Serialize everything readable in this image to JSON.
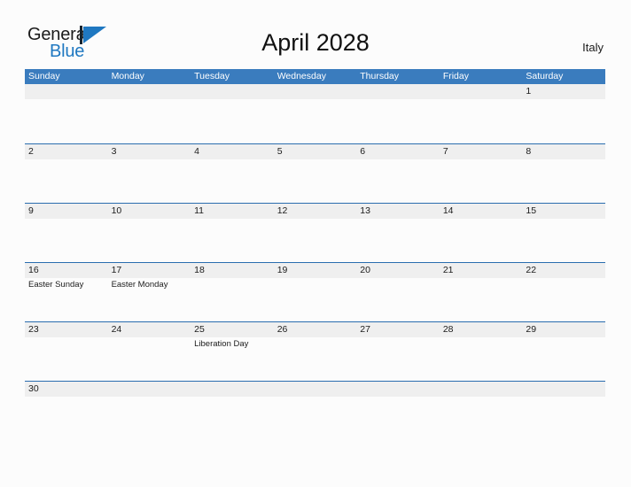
{
  "brand": {
    "name_part1": "General",
    "name_part2": "Blue",
    "accent_color": "#1f78c1"
  },
  "header": {
    "title": "April 2028",
    "country": "Italy"
  },
  "theme": {
    "header_blue": "#3a7cbe",
    "rule_blue": "#2a6daf",
    "band_gray": "#efefef",
    "page_background": "#fcfcfc"
  },
  "calendar": {
    "day_headers": [
      "Sunday",
      "Monday",
      "Tuesday",
      "Wednesday",
      "Thursday",
      "Friday",
      "Saturday"
    ],
    "weeks": [
      {
        "short": false,
        "days": [
          {
            "num": "",
            "events": []
          },
          {
            "num": "",
            "events": []
          },
          {
            "num": "",
            "events": []
          },
          {
            "num": "",
            "events": []
          },
          {
            "num": "",
            "events": []
          },
          {
            "num": "",
            "events": []
          },
          {
            "num": "1",
            "events": []
          }
        ]
      },
      {
        "short": false,
        "days": [
          {
            "num": "2",
            "events": []
          },
          {
            "num": "3",
            "events": []
          },
          {
            "num": "4",
            "events": []
          },
          {
            "num": "5",
            "events": []
          },
          {
            "num": "6",
            "events": []
          },
          {
            "num": "7",
            "events": []
          },
          {
            "num": "8",
            "events": []
          }
        ]
      },
      {
        "short": false,
        "days": [
          {
            "num": "9",
            "events": []
          },
          {
            "num": "10",
            "events": []
          },
          {
            "num": "11",
            "events": []
          },
          {
            "num": "12",
            "events": []
          },
          {
            "num": "13",
            "events": []
          },
          {
            "num": "14",
            "events": []
          },
          {
            "num": "15",
            "events": []
          }
        ]
      },
      {
        "short": false,
        "days": [
          {
            "num": "16",
            "events": [
              "Easter Sunday"
            ]
          },
          {
            "num": "17",
            "events": [
              "Easter Monday"
            ]
          },
          {
            "num": "18",
            "events": []
          },
          {
            "num": "19",
            "events": []
          },
          {
            "num": "20",
            "events": []
          },
          {
            "num": "21",
            "events": []
          },
          {
            "num": "22",
            "events": []
          }
        ]
      },
      {
        "short": false,
        "days": [
          {
            "num": "23",
            "events": []
          },
          {
            "num": "24",
            "events": []
          },
          {
            "num": "25",
            "events": [
              "Liberation Day"
            ]
          },
          {
            "num": "26",
            "events": []
          },
          {
            "num": "27",
            "events": []
          },
          {
            "num": "28",
            "events": []
          },
          {
            "num": "29",
            "events": []
          }
        ]
      },
      {
        "short": true,
        "days": [
          {
            "num": "30",
            "events": []
          },
          {
            "num": "",
            "events": []
          },
          {
            "num": "",
            "events": []
          },
          {
            "num": "",
            "events": []
          },
          {
            "num": "",
            "events": []
          },
          {
            "num": "",
            "events": []
          },
          {
            "num": "",
            "events": []
          }
        ]
      }
    ]
  }
}
